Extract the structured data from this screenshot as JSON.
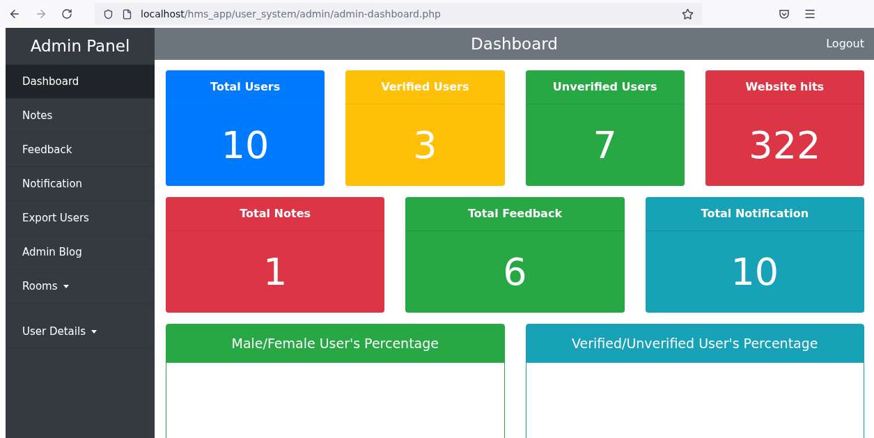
{
  "browser": {
    "url_host": "localhost",
    "url_path": "/hms_app/user_system/admin/admin-dashboard.php"
  },
  "sidebar": {
    "title": "Admin Panel",
    "items": [
      {
        "label": "Dashboard",
        "selected": true,
        "dropdown": false
      },
      {
        "label": "Notes",
        "selected": false,
        "dropdown": false
      },
      {
        "label": "Feedback",
        "selected": false,
        "dropdown": false
      },
      {
        "label": "Notification",
        "selected": false,
        "dropdown": false
      },
      {
        "label": "Export Users",
        "selected": false,
        "dropdown": false
      },
      {
        "label": "Admin Blog",
        "selected": false,
        "dropdown": false
      },
      {
        "label": "Rooms",
        "selected": false,
        "dropdown": true
      },
      {
        "label": "User Details",
        "selected": false,
        "dropdown": true
      }
    ]
  },
  "header": {
    "title": "Dashboard",
    "logout": "Logout"
  },
  "stat_rows": [
    [
      {
        "title": "Total Users",
        "value": "10",
        "color": "#007bff"
      },
      {
        "title": "Verified Users",
        "value": "3",
        "color": "#ffc107"
      },
      {
        "title": "Unverified Users",
        "value": "7",
        "color": "#28a745"
      },
      {
        "title": "Website hits",
        "value": "322",
        "color": "#dc3545"
      }
    ],
    [
      {
        "title": "Total Notes",
        "value": "1",
        "color": "#dc3545"
      },
      {
        "title": "Total Feedback",
        "value": "6",
        "color": "#28a745"
      },
      {
        "title": "Total Notification",
        "value": "10",
        "color": "#17a2b8"
      }
    ]
  ],
  "panels": [
    {
      "title": "Male/Female User's Percentage",
      "color": "#28a745"
    },
    {
      "title": "Verified/Unverified User's Percentage",
      "color": "#17a2b8"
    }
  ]
}
